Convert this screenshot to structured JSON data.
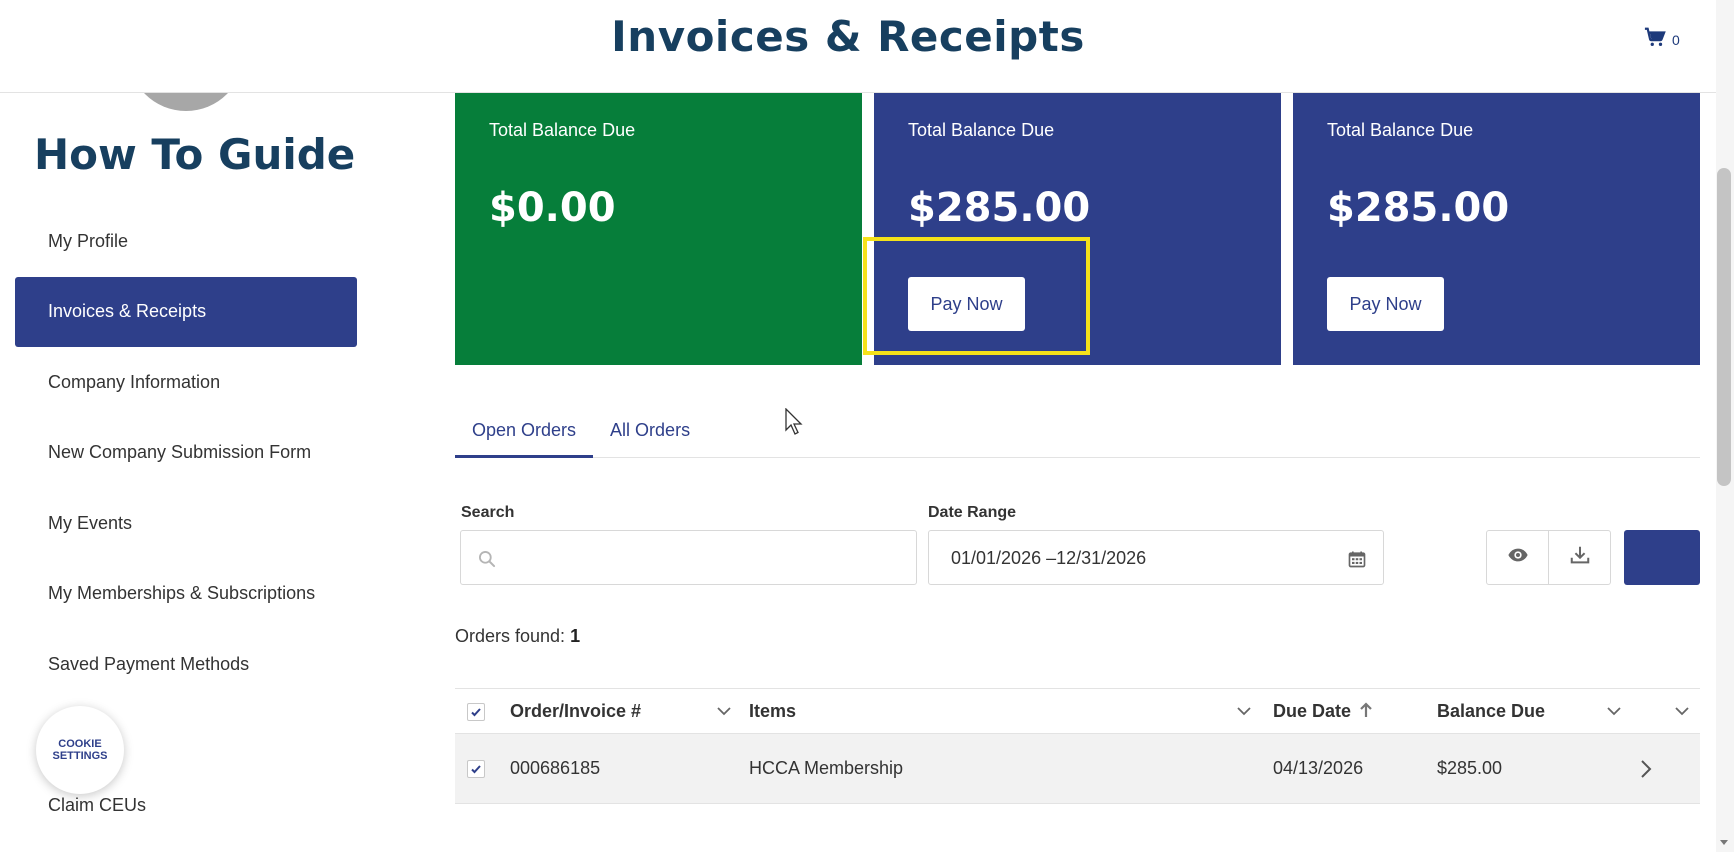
{
  "header": {
    "title": "Invoices & Receipts",
    "cart_count": "0"
  },
  "sidebar": {
    "title": "How To Guide",
    "items": [
      {
        "label": "My Profile"
      },
      {
        "label": "Invoices & Receipts"
      },
      {
        "label": "Company Information"
      },
      {
        "label": "New Company Submission Form"
      },
      {
        "label": "My Events"
      },
      {
        "label": "My Memberships & Subscriptions"
      },
      {
        "label": "Saved Payment Methods"
      },
      {
        "label": ""
      },
      {
        "label": "Claim CEUs"
      }
    ],
    "active_index": 1,
    "cookie_label": "COOKIE\nSETTINGS"
  },
  "cards": [
    {
      "label": "Total Balance Due",
      "amount": "$0.00",
      "color": "#067e3a"
    },
    {
      "label": "Total Balance Due",
      "amount": "$285.00",
      "button": "Pay Now",
      "color": "#2e3f8a"
    },
    {
      "label": "Total Balance Due",
      "amount": "$285.00",
      "button": "Pay Now",
      "color": "#2e3f8a"
    }
  ],
  "tabs": [
    {
      "label": "Open Orders",
      "active": true
    },
    {
      "label": "All Orders",
      "active": false
    }
  ],
  "filters": {
    "search_label": "Search",
    "search_value": "",
    "date_label": "Date Range",
    "date_value": "01/01/2026 –12/31/2026"
  },
  "orders_found": {
    "label": "Orders found:",
    "count": "1"
  },
  "table": {
    "columns": [
      "Order/Invoice #",
      "Items",
      "Due Date",
      "Balance Due"
    ],
    "rows": [
      {
        "order": "000686185",
        "items": "HCCA Membership",
        "due_date": "04/13/2026",
        "balance": "$285.00"
      }
    ]
  },
  "colors": {
    "brand_navy": "#2e3f8a",
    "success_green": "#067e3a",
    "title_color": "#173f5f",
    "highlight": "#f5e21a"
  }
}
